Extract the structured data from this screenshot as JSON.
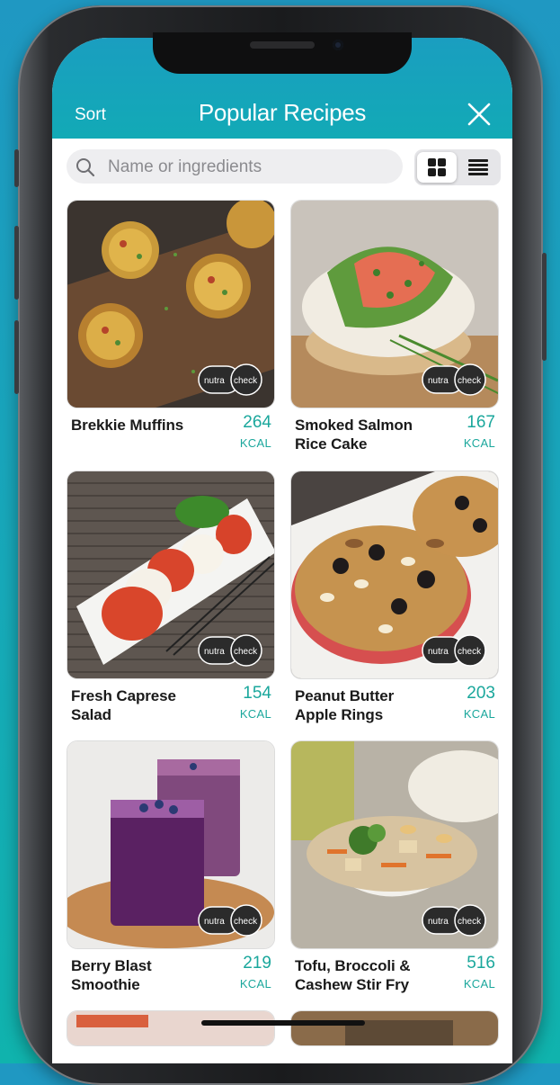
{
  "header": {
    "sort_label": "Sort",
    "title": "Popular Recipes",
    "close_icon": "close-icon"
  },
  "search": {
    "placeholder": "Name or ingredients",
    "value": "",
    "icon": "search-icon"
  },
  "view_toggle": {
    "selected": "grid",
    "options": [
      "grid-view-icon",
      "list-view-icon"
    ]
  },
  "recipes": [
    {
      "name": "Brekkie Muffins",
      "kcal": "264",
      "unit": "KCAL",
      "badge": "nutracheck"
    },
    {
      "name": "Smoked Salmon Rice Cake",
      "kcal": "167",
      "unit": "KCAL",
      "badge": "nutracheck"
    },
    {
      "name": "Fresh Caprese Salad",
      "kcal": "154",
      "unit": "KCAL",
      "badge": "nutracheck"
    },
    {
      "name": "Peanut Butter Apple Rings",
      "kcal": "203",
      "unit": "KCAL",
      "badge": "nutracheck"
    },
    {
      "name": "Berry Blast Smoothie",
      "kcal": "219",
      "unit": "KCAL",
      "badge": "nutracheck"
    },
    {
      "name": "Tofu, Broccoli & Cashew Stir Fry",
      "kcal": "516",
      "unit": "KCAL",
      "badge": "nutracheck"
    }
  ],
  "colors": {
    "header_bg": "#12aab6",
    "accent_kcal": "#1aa79c",
    "background": "#1f98c2"
  }
}
